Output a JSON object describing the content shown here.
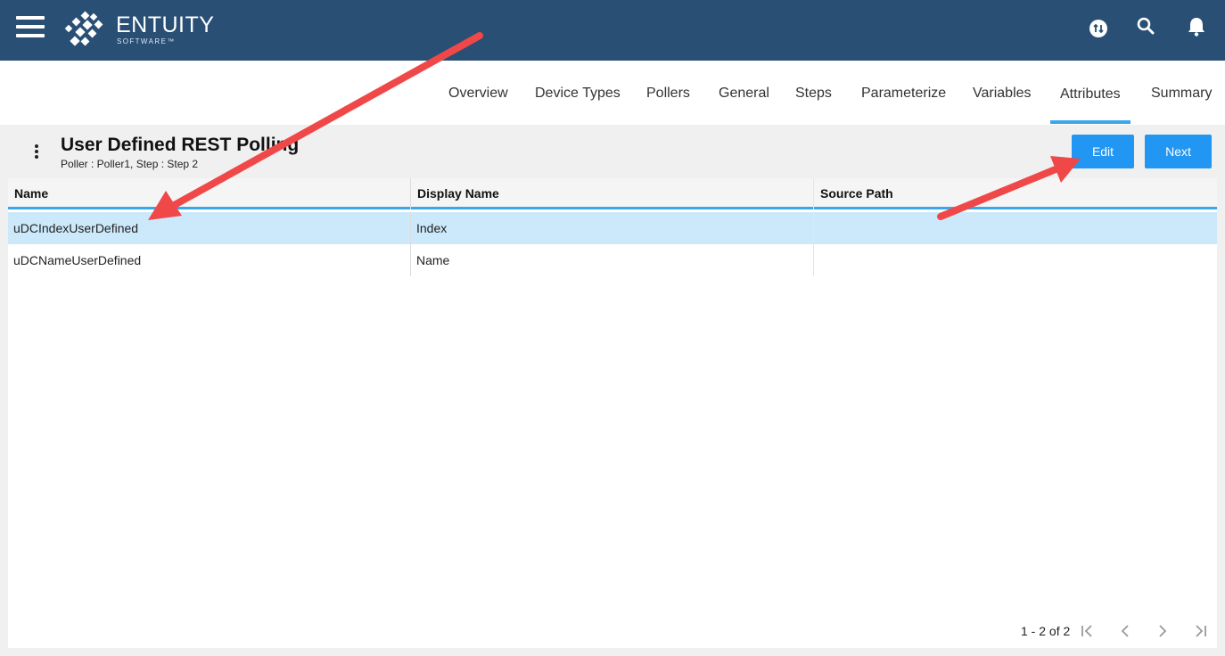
{
  "app": {
    "brand": "ENTUITY",
    "brand_sub": "SOFTWARE™",
    "colors": {
      "topbar": "#294f74",
      "accent": "#2196f3",
      "tab_indicator": "#3aa6ec",
      "selected_row": "#cce9fb",
      "annotation_arrow": "#f04848"
    }
  },
  "topbar": {
    "icons": [
      "menu-icon",
      "sync-icon",
      "search-icon",
      "bell-icon"
    ]
  },
  "tabs": [
    {
      "label": "Overview"
    },
    {
      "label": "Device Types"
    },
    {
      "label": "Pollers"
    },
    {
      "label": "General"
    },
    {
      "label": "Steps"
    },
    {
      "label": "Parameterize"
    },
    {
      "label": "Variables"
    },
    {
      "label": "Attributes",
      "active": true
    },
    {
      "label": "Summary"
    }
  ],
  "page": {
    "title": "User Defined REST Polling",
    "subtitle": "Poller : Poller1, Step : Step 2",
    "edit_label": "Edit",
    "next_label": "Next"
  },
  "table": {
    "columns": [
      "Name",
      "Display Name",
      "Source Path"
    ],
    "rows": [
      {
        "name": "uDCIndexUserDefined",
        "display_name": "Index",
        "source_path": "",
        "selected": true
      },
      {
        "name": "uDCNameUserDefined",
        "display_name": "Name",
        "source_path": "",
        "selected": false
      }
    ]
  },
  "pager": {
    "summary": "1 - 2 of 2",
    "icons": [
      "first-page-icon",
      "prev-page-icon",
      "next-page-icon",
      "last-page-icon"
    ]
  }
}
